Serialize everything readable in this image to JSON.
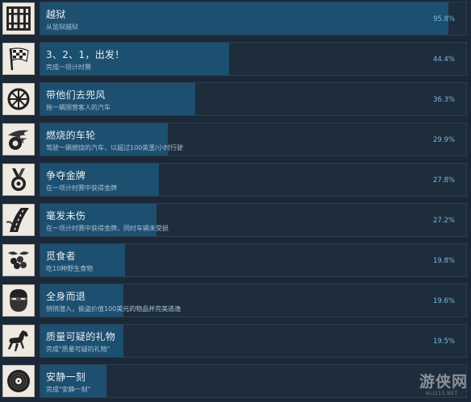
{
  "achievements": [
    {
      "title": "越狱",
      "description": "从监狱越狱",
      "percent": "95.8%",
      "fill": 0.958,
      "icon": "prison-bars-icon"
    },
    {
      "title": "3、2、1，出发！",
      "description": "完成一项计时赛",
      "percent": "44.4%",
      "fill": 0.444,
      "icon": "checkered-flag-icon"
    },
    {
      "title": "带他们去兜风",
      "description": "拖一辆国营客人的汽车",
      "percent": "36.3%",
      "fill": 0.363,
      "icon": "steering-wheel-icon"
    },
    {
      "title": "燃烧的车轮",
      "description": "驾驶一辆燃烧的汽车，以超过100英里/小时行驶",
      "percent": "29.9%",
      "fill": 0.299,
      "icon": "flaming-wheel-icon"
    },
    {
      "title": "争夺金牌",
      "description": "在一项计时赛中获得金牌",
      "percent": "27.8%",
      "fill": 0.278,
      "icon": "medal-icon"
    },
    {
      "title": "毫发未伤",
      "description": "在一项计时赛中获得金牌，同时车辆未受损",
      "percent": "27.2%",
      "fill": 0.272,
      "icon": "road-icon"
    },
    {
      "title": "觅食者",
      "description": "吃10种野生食物",
      "percent": "19.8%",
      "fill": 0.198,
      "icon": "berries-icon"
    },
    {
      "title": "全身而退",
      "description": "悄悄潜入，偷盗价值100美元的物品并完美逃逸",
      "percent": "19.6%",
      "fill": 0.196,
      "icon": "masked-face-icon"
    },
    {
      "title": "质量可疑的礼物",
      "description": "完成\"质量可疑的礼物\"",
      "percent": "19.5%",
      "fill": 0.195,
      "icon": "horse-icon"
    },
    {
      "title": "安静一刻",
      "description": "完成\"安静一刻\"",
      "percent": "",
      "fill": 0.155,
      "icon": "vinyl-record-icon"
    }
  ],
  "watermark": {
    "text": "游侠网",
    "sub": "ALI213.NET"
  }
}
